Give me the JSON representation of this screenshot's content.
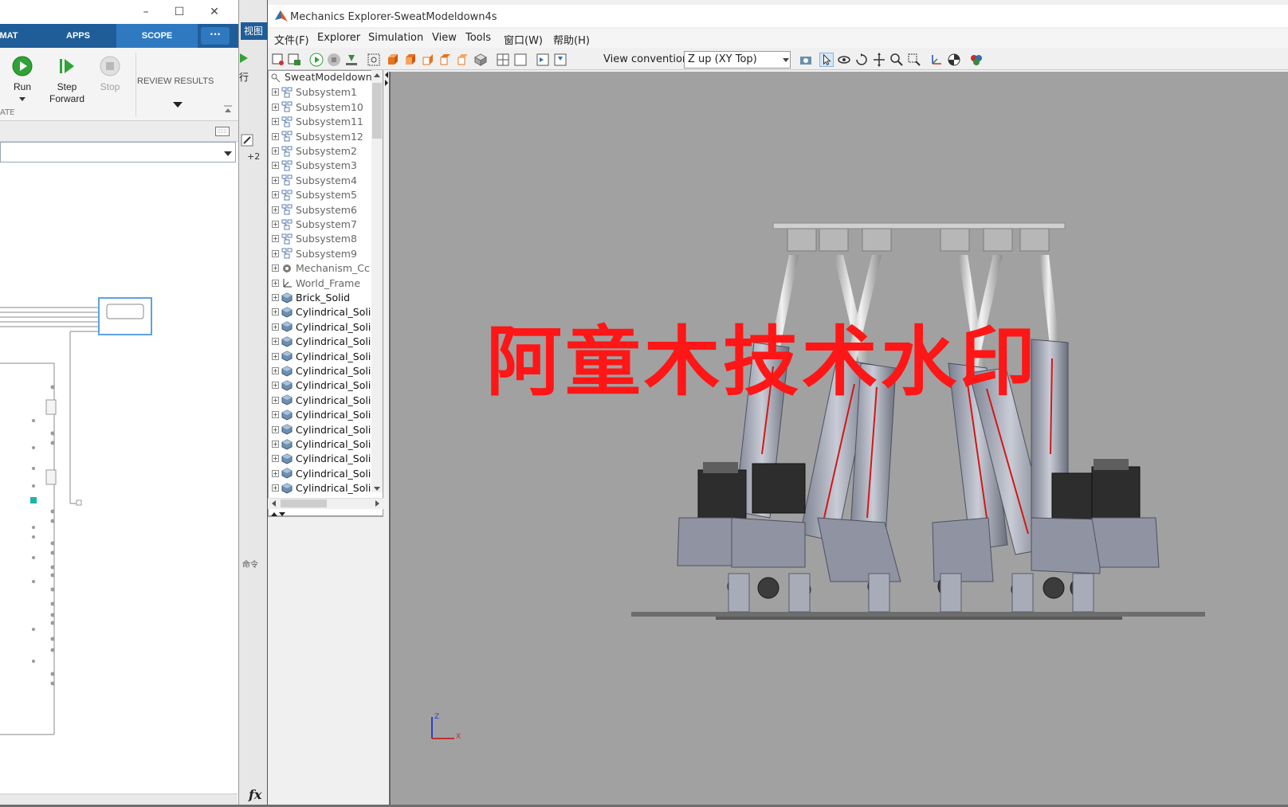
{
  "simulink": {
    "tabs": [
      "MAT",
      "APPS",
      "SCOPE"
    ],
    "more_label": "···",
    "run_label": "Run",
    "step_forward_label": "Step\nForward",
    "stop_label": "Stop",
    "review_results_label": "REVIEW RESULTS",
    "ate_label": "ATE"
  },
  "midstrip": {
    "view_label": "视图",
    "run_label": "行",
    "fx_label": "fx"
  },
  "mechanics": {
    "title": "Mechanics Explorer-SweatModeldown4s",
    "menu": [
      {
        "label": "文件(F)"
      },
      {
        "label": "Explorer"
      },
      {
        "label": "Simulation"
      },
      {
        "label": "View"
      },
      {
        "label": "Tools"
      },
      {
        "label": "窗口(W)"
      },
      {
        "label": "帮助(H)"
      }
    ],
    "view_convention_label": "View convention:",
    "view_convention_value": "Z up (XY Top)",
    "tree": {
      "root": "SweatModeldown",
      "items": [
        {
          "label": "Subsystem1",
          "kind": "subsystem"
        },
        {
          "label": "Subsystem10",
          "kind": "subsystem"
        },
        {
          "label": "Subsystem11",
          "kind": "subsystem"
        },
        {
          "label": "Subsystem12",
          "kind": "subsystem"
        },
        {
          "label": "Subsystem2",
          "kind": "subsystem"
        },
        {
          "label": "Subsystem3",
          "kind": "subsystem"
        },
        {
          "label": "Subsystem4",
          "kind": "subsystem"
        },
        {
          "label": "Subsystem5",
          "kind": "subsystem"
        },
        {
          "label": "Subsystem6",
          "kind": "subsystem"
        },
        {
          "label": "Subsystem7",
          "kind": "subsystem"
        },
        {
          "label": "Subsystem8",
          "kind": "subsystem"
        },
        {
          "label": "Subsystem9",
          "kind": "subsystem"
        },
        {
          "label": "Mechanism_Cc",
          "kind": "mechanism"
        },
        {
          "label": "World_Frame",
          "kind": "frame"
        },
        {
          "label": "Brick_Solid",
          "kind": "solid"
        },
        {
          "label": "Cylindrical_Soli",
          "kind": "solid"
        },
        {
          "label": "Cylindrical_Soli",
          "kind": "solid"
        },
        {
          "label": "Cylindrical_Soli",
          "kind": "solid"
        },
        {
          "label": "Cylindrical_Soli",
          "kind": "solid"
        },
        {
          "label": "Cylindrical_Soli",
          "kind": "solid"
        },
        {
          "label": "Cylindrical_Soli",
          "kind": "solid"
        },
        {
          "label": "Cylindrical_Soli",
          "kind": "solid"
        },
        {
          "label": "Cylindrical_Soli",
          "kind": "solid"
        },
        {
          "label": "Cylindrical_Soli",
          "kind": "solid"
        },
        {
          "label": "Cylindrical_Soli",
          "kind": "solid"
        },
        {
          "label": "Cylindrical_Soli",
          "kind": "solid"
        },
        {
          "label": "Cylindrical_Soli",
          "kind": "solid"
        },
        {
          "label": "Cylindrical_Soli",
          "kind": "solid"
        }
      ]
    },
    "watermark": "阿童木技术水印",
    "axis_triad": {
      "z": "Z",
      "x": "X"
    }
  },
  "colors": {
    "ribbon_blue": "#1f5d99",
    "viewport_gray": "#a1a1a1",
    "watermark_red": "#ff1616",
    "run_green": "#2fa336"
  }
}
